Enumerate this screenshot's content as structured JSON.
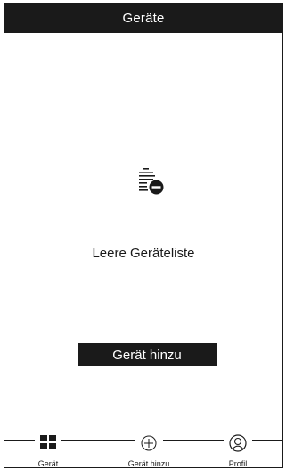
{
  "header": {
    "title": "Geräte"
  },
  "empty_state": {
    "icon": "list-remove-icon",
    "label": "Leere Geräteliste"
  },
  "actions": {
    "add_device_label": "Gerät hinzu"
  },
  "bottom_nav": {
    "items": [
      {
        "label": "Gerät",
        "icon": "grid-icon",
        "active": true
      },
      {
        "label": "Gerät hinzu",
        "icon": "plus-circle-icon",
        "active": false
      },
      {
        "label": "Profil",
        "icon": "user-icon",
        "active": false
      }
    ]
  },
  "colors": {
    "primary": "#1a1a1a",
    "background": "#ffffff",
    "on_primary": "#ffffff"
  }
}
